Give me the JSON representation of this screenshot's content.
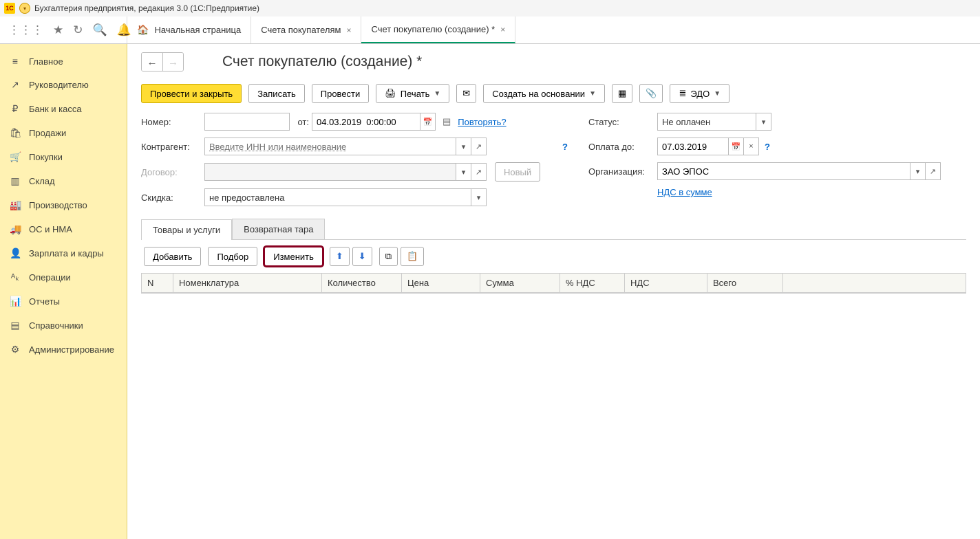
{
  "titlebar": {
    "app_name": "Бухгалтерия предприятия, редакция 3.0   (1С:Предприятие)"
  },
  "tabs": {
    "home": "Начальная страница",
    "t1": "Счета покупателям",
    "t2": "Счет покупателю (создание) *"
  },
  "sidebar": [
    {
      "icon": "≡",
      "label": "Главное"
    },
    {
      "icon": "↗",
      "label": "Руководителю"
    },
    {
      "icon": "₽",
      "label": "Банк и касса"
    },
    {
      "icon": "🛍",
      "label": "Продажи"
    },
    {
      "icon": "🛒",
      "label": "Покупки"
    },
    {
      "icon": "▥",
      "label": "Склад"
    },
    {
      "icon": "🏭",
      "label": "Производство"
    },
    {
      "icon": "🚚",
      "label": "ОС и НМА"
    },
    {
      "icon": "👤",
      "label": "Зарплата и кадры"
    },
    {
      "icon": "ᴬₖ",
      "label": "Операции"
    },
    {
      "icon": "📊",
      "label": "Отчеты"
    },
    {
      "icon": "▤",
      "label": "Справочники"
    },
    {
      "icon": "⚙",
      "label": "Администрирование"
    }
  ],
  "page": {
    "title": "Счет покупателю (создание) *"
  },
  "cmd": {
    "post_close": "Провести и закрыть",
    "save": "Записать",
    "post": "Провести",
    "print": "Печать",
    "create_based": "Создать на основании",
    "edo": "ЭДО"
  },
  "form": {
    "number_lbl": "Номер:",
    "from_lbl": "от:",
    "date_value": "04.03.2019  0:00:00",
    "repeat": "Повторять?",
    "counterparty_lbl": "Контрагент:",
    "counterparty_ph": "Введите ИНН или наименование",
    "contract_lbl": "Договор:",
    "new_btn": "Новый",
    "discount_lbl": "Скидка:",
    "discount_value": "не предоставлена",
    "status_lbl": "Статус:",
    "status_value": "Не оплачен",
    "paydue_lbl": "Оплата до:",
    "paydue_value": "07.03.2019",
    "org_lbl": "Организация:",
    "org_value": "ЗАО ЭПОС",
    "vat_link": "НДС в сумме"
  },
  "subtabs": {
    "t1": "Товары и услуги",
    "t2": "Возвратная тара"
  },
  "gridbar": {
    "add": "Добавить",
    "pick": "Подбор",
    "edit": "Изменить"
  },
  "gridhead": {
    "n": "N",
    "nom": "Номенклатура",
    "qty": "Количество",
    "price": "Цена",
    "sum": "Сумма",
    "vatp": "% НДС",
    "vat": "НДС",
    "total": "Всего"
  }
}
